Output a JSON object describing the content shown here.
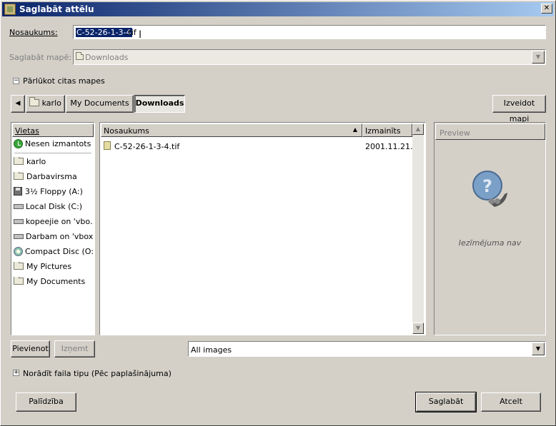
{
  "window": {
    "title": "Saglabāt attēlu",
    "close_glyph": "✕"
  },
  "name_row": {
    "label": "Nosaukums:",
    "value_selected": "C-52-26-1-3-4",
    "value_rest": ".tif"
  },
  "folder_row": {
    "label": "Saglabāt mapē:",
    "value": "Downloads"
  },
  "browse_toggle": {
    "label": "Pārlūkot citas mapes",
    "state": "expanded"
  },
  "path_bar": {
    "back_glyph": "◀",
    "crumbs": [
      "karlo",
      "My Documents",
      "Downloads"
    ],
    "active_crumb": "Downloads",
    "create_folder_label": "Izveidot mapi"
  },
  "places": {
    "header": "Vietas",
    "items": [
      {
        "label": "Nesen izmantots",
        "icon": "recent-icon"
      },
      {
        "label": "karlo",
        "icon": "folder-icon"
      },
      {
        "label": "Darbavirsma",
        "icon": "folder-icon"
      },
      {
        "label": "3½ Floppy (A:)",
        "icon": "floppy-icon"
      },
      {
        "label": "Local Disk (C:)",
        "icon": "drive-icon"
      },
      {
        "label": "kopeejie on 'vbo…",
        "icon": "network-drive-icon"
      },
      {
        "label": "Darbam on 'vbox…",
        "icon": "network-drive-icon"
      },
      {
        "label": "Compact Disc (O:)",
        "icon": "cd-icon"
      },
      {
        "label": "My Pictures",
        "icon": "folder-icon"
      },
      {
        "label": "My Documents",
        "icon": "folder-icon"
      }
    ],
    "add_button": "Pievienot",
    "remove_button": "Izņemt"
  },
  "files": {
    "col_name": "Nosaukums",
    "col_modified": "Izmainīts",
    "sort_glyph": "▲",
    "rows": [
      {
        "name": "C-52-26-1-3-4.tif",
        "modified": "2001.11.21."
      }
    ]
  },
  "preview": {
    "header": "Preview",
    "empty_text": "Iezīmējuma nav"
  },
  "filter": {
    "value": "All images",
    "arrow_glyph": "▼"
  },
  "filetype_toggle": {
    "label": "Norādīt faila tipu (Pēc paplašinājuma)",
    "state": "collapsed"
  },
  "footer": {
    "help": "Palīdzība",
    "save": "Saglabāt",
    "cancel": "Atcelt"
  }
}
